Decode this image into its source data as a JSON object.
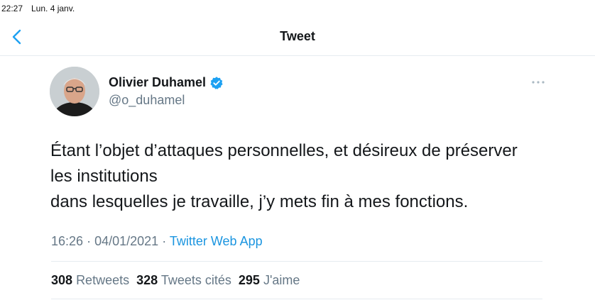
{
  "status_bar": {
    "time": "22:27",
    "date": "Lun. 4 janv."
  },
  "nav": {
    "title": "Tweet",
    "back_icon": "chevron-left-icon"
  },
  "colors": {
    "accent": "#1b95e0",
    "verified": "#1da1f2",
    "secondary_text": "#657786",
    "primary_text": "#14171a",
    "divider": "#e6ecf0"
  },
  "tweet": {
    "author": {
      "name": "Olivier Duhamel",
      "handle": "@o_duhamel",
      "verified": true
    },
    "text_lines": [
      "Étant l’objet d’attaques personnelles, et désireux de préserver",
      "les institutions",
      "dans lesquelles je travaille, j’y mets fin à mes fonctions."
    ],
    "time": "16:26",
    "date": "04/01/2021",
    "separator": "·",
    "source": "Twitter Web App"
  },
  "stats": {
    "retweets": {
      "count": "308",
      "label": "Retweets"
    },
    "quotes": {
      "count": "328",
      "label": "Tweets cités"
    },
    "likes": {
      "count": "295",
      "label": "J'aime"
    }
  }
}
